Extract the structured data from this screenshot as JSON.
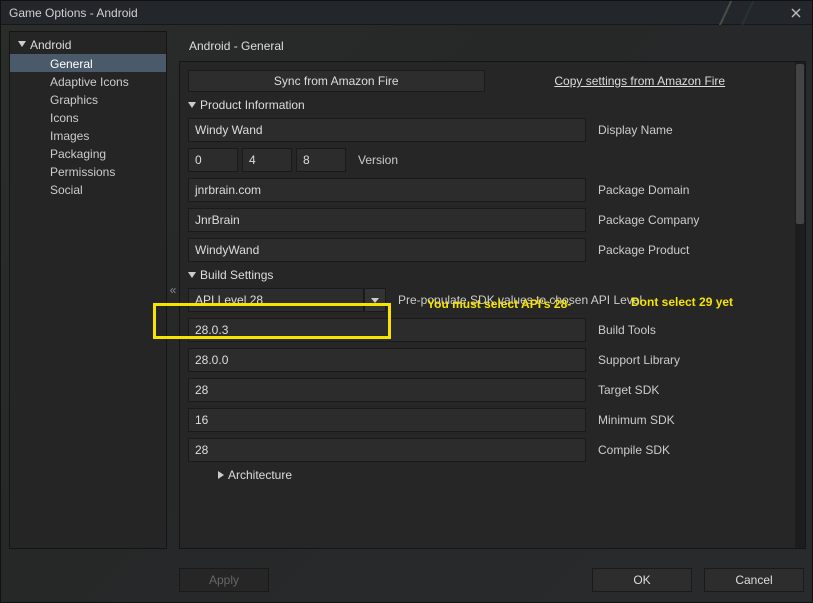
{
  "window": {
    "title": "Game Options - Android"
  },
  "sidebar": {
    "root": "Android",
    "items": [
      {
        "label": "General",
        "selected": true
      },
      {
        "label": "Adaptive Icons"
      },
      {
        "label": "Graphics"
      },
      {
        "label": "Icons"
      },
      {
        "label": "Images"
      },
      {
        "label": "Packaging"
      },
      {
        "label": "Permissions"
      },
      {
        "label": "Social"
      }
    ]
  },
  "main": {
    "header": "Android - General",
    "sync_button": "Sync from Amazon Fire",
    "copy_link": "Copy settings from Amazon Fire",
    "sections": {
      "product_info": {
        "title": "Product Information",
        "display_name": {
          "label": "Display Name",
          "value": "Windy Wand"
        },
        "version": {
          "label": "Version",
          "major": "0",
          "minor": "4",
          "patch": "8"
        },
        "package_domain": {
          "label": "Package Domain",
          "value": "jnrbrain.com"
        },
        "package_company": {
          "label": "Package Company",
          "value": "JnrBrain"
        },
        "package_product": {
          "label": "Package Product",
          "value": "WindyWand"
        }
      },
      "build_settings": {
        "title": "Build Settings",
        "api_level": {
          "label": "Pre-populate SDK values to chosen API Level",
          "value": "API Level 28"
        },
        "build_tools": {
          "label": "Build Tools",
          "value": "28.0.3"
        },
        "support_library": {
          "label": "Support Library",
          "value": "28.0.0"
        },
        "target_sdk": {
          "label": "Target SDK",
          "value": "28"
        },
        "minimum_sdk": {
          "label": "Minimum SDK",
          "value": "16"
        },
        "compile_sdk": {
          "label": "Compile SDK",
          "value": "28"
        }
      },
      "architecture": {
        "title": "Architecture"
      }
    }
  },
  "annotations": {
    "note1": "You must select API's 28-",
    "note2": "Dont select 29 yet"
  },
  "footer": {
    "apply": "Apply",
    "ok": "OK",
    "cancel": "Cancel"
  }
}
